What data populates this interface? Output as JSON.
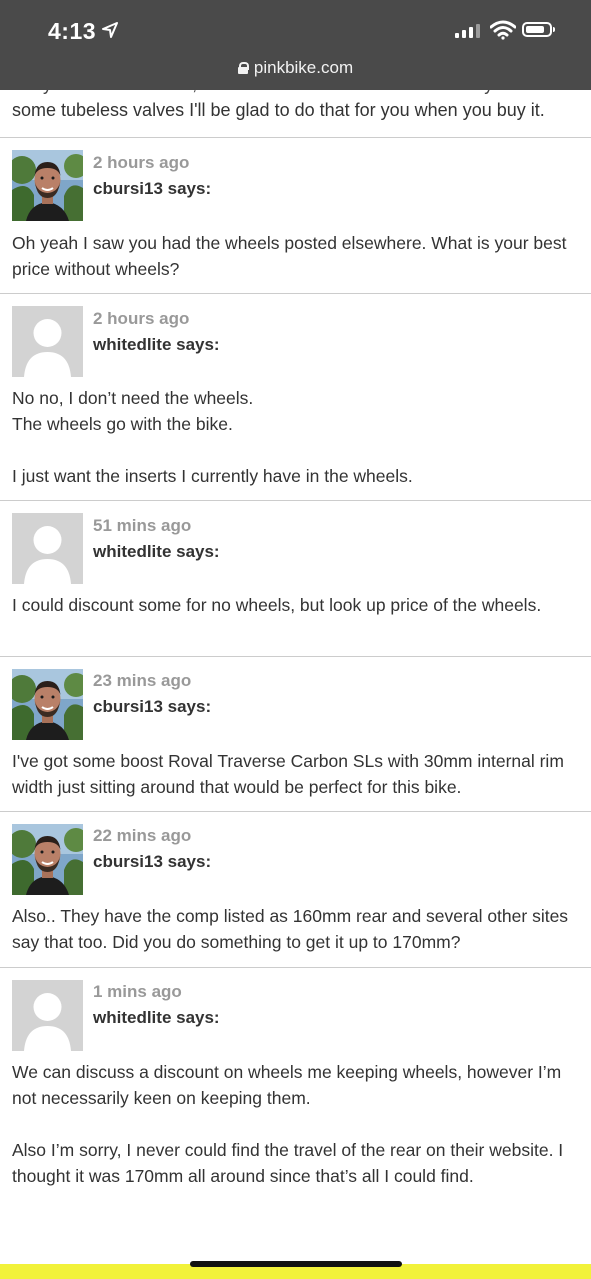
{
  "status_bar": {
    "time": "4:13",
    "url": "pinkbike.com"
  },
  "partial_comment": {
    "line1": "They are tubeless now, but will have tube in it when unless you have",
    "line2": "some tubeless valves I'll be glad to do that for you when you buy it."
  },
  "comments": [
    {
      "time": "2 hours ago",
      "user": "cbursi13 says:",
      "avatar": "photo",
      "lines": [
        "Oh yeah I saw you had the wheels posted elsewhere. What is your best price without wheels?"
      ]
    },
    {
      "time": "2 hours ago",
      "user": "whitedlite says:",
      "avatar": "placeholder",
      "lines": [
        "No no, I don’t need the wheels.",
        "The wheels go with the bike.",
        "",
        "I just want the inserts I currently have in the wheels."
      ]
    },
    {
      "time": "51 mins ago",
      "user": "whitedlite says:",
      "avatar": "placeholder",
      "lines": [
        "I could discount some for no wheels, but look up price of the wheels."
      ]
    },
    {
      "time": "23 mins ago",
      "user": "cbursi13 says:",
      "avatar": "photo",
      "lines": [
        "I've got some boost Roval Traverse Carbon SLs with 30mm internal rim width just sitting around that would be perfect for this bike."
      ]
    },
    {
      "time": "22 mins ago",
      "user": "cbursi13 says:",
      "avatar": "photo",
      "lines": [
        "Also.. They have the comp listed as 160mm rear and several other sites say that too. Did you do something to get it up to 170mm?"
      ]
    },
    {
      "time": "1 mins ago",
      "user": "whitedlite says:",
      "avatar": "placeholder",
      "lines": [
        "We can discuss a discount on wheels me keeping wheels, however I’m not necessarily keen on keeping them.",
        "",
        "Also I’m sorry, I never could find the travel of the rear on their website. I thought it was 170mm all around since that’s all I could find."
      ]
    }
  ],
  "colors": {
    "status_bg": "#4a4a4a",
    "divider": "#cccccc",
    "meta_time": "#999999",
    "bottom_strip": "#f2f23a"
  }
}
